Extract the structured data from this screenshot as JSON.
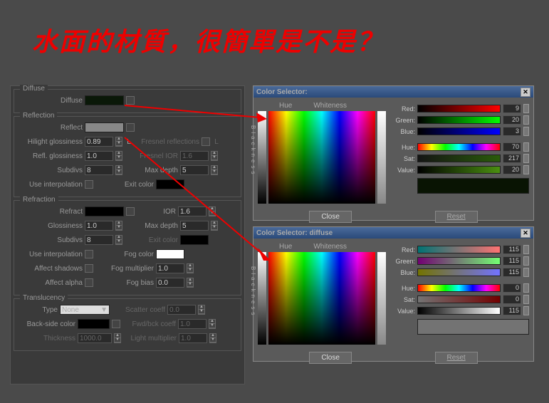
{
  "title": "水面的材質，很簡單是不是？",
  "diffuse": {
    "legend": "Diffuse",
    "label": "Diffuse",
    "color": "#0a1808"
  },
  "reflection": {
    "legend": "Reflection",
    "reflect_label": "Reflect",
    "reflect_color": "#888888",
    "hilight_label": "Hilight glossiness",
    "hilight_val": "0.89",
    "l_label": "L",
    "fresnel_label": "Fresnel reflections",
    "refl_gloss_label": "Refl. glossiness",
    "refl_gloss_val": "1.0",
    "fresnel_ior_label": "Fresnel IOR",
    "fresnel_ior_val": "1.6",
    "subdivs_label": "Subdivs",
    "subdivs_val": "8",
    "maxdepth_label": "Max depth",
    "maxdepth_val": "5",
    "interp_label": "Use interpolation",
    "exit_label": "Exit color",
    "exit_color": "#000000"
  },
  "refraction": {
    "legend": "Refraction",
    "refract_label": "Refract",
    "refract_color": "#000000",
    "ior_label": "IOR",
    "ior_val": "1.6",
    "gloss_label": "Glossiness",
    "gloss_val": "1.0",
    "maxdepth_label": "Max depth",
    "maxdepth_val": "5",
    "subdivs_label": "Subdivs",
    "subdivs_val": "8",
    "exit_label": "Exit color",
    "exit_color": "#000000",
    "interp_label": "Use interpolation",
    "fog_label": "Fog color",
    "fog_color": "#ffffff",
    "shadows_label": "Affect shadows",
    "fogmult_label": "Fog multiplier",
    "fogmult_val": "1.0",
    "alpha_label": "Affect alpha",
    "fogbias_label": "Fog bias",
    "fogbias_val": "0.0"
  },
  "translucency": {
    "legend": "Translucency",
    "type_label": "Type",
    "type_val": "None",
    "scatter_label": "Scatter coeff",
    "scatter_val": "0.0",
    "back_label": "Back-side color",
    "back_color": "#000000",
    "fwdbck_label": "Fwd/bck coeff",
    "fwdbck_val": "1.0",
    "thick_label": "Thickness",
    "thick_val": "1000.0",
    "lightmult_label": "Light multiplier",
    "lightmult_val": "1.0"
  },
  "cs1": {
    "title": "Color Selector:",
    "hue_label": "Hue",
    "white_label": "Whiteness",
    "black_label": "Blackness",
    "red_label": "Red:",
    "red_val": "9",
    "green_label": "Green:",
    "green_val": "20",
    "blue_label": "Blue:",
    "blue_val": "3",
    "hue2_label": "Hue:",
    "hue2_val": "70",
    "sat_label": "Sat:",
    "sat_val": "217",
    "value_label": "Value:",
    "value_val": "20",
    "preview_color": "#091403",
    "close": "Close",
    "reset": "Reset"
  },
  "cs2": {
    "title": "Color Selector: diffuse",
    "hue_label": "Hue",
    "white_label": "Whiteness",
    "black_label": "Blackness",
    "red_label": "Red:",
    "red_val": "115",
    "green_label": "Green:",
    "green_val": "115",
    "blue_label": "Blue:",
    "blue_val": "115",
    "hue2_label": "Hue:",
    "hue2_val": "0",
    "sat_label": "Sat:",
    "sat_val": "0",
    "value_label": "Value:",
    "value_val": "115",
    "preview_color": "#737373",
    "close": "Close",
    "reset": "Reset"
  }
}
